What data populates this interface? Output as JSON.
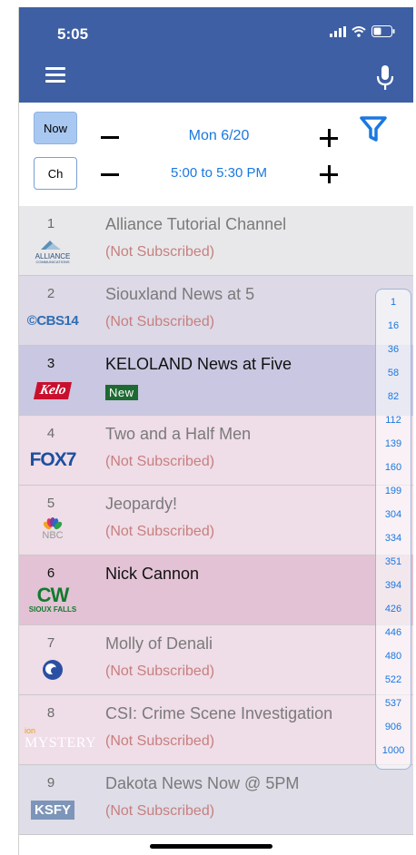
{
  "status_bar": {
    "time": "5:05"
  },
  "controls": {
    "now_label": "Now",
    "ch_label": "Ch",
    "date_text": "Mon 6/20",
    "time_range_text": "5:00 to 5:30 PM"
  },
  "channels": [
    {
      "num": "1",
      "title": "Alliance Tutorial Channel",
      "status": "(Not Subscribed)",
      "logo": "ALLIANCE",
      "logo_sub": "COMMUNICATIONS",
      "bg": "#e8e8ea"
    },
    {
      "num": "2",
      "title": "Siouxland News at 5",
      "status": "(Not Subscribed)",
      "logo": "©CBS14",
      "bg": "#ddd9e6"
    },
    {
      "num": "3",
      "title": "KELOLAND News at Five",
      "status": "New",
      "logo": "Kelo",
      "bg": "#c9c7e1"
    },
    {
      "num": "4",
      "title": "Two and a Half Men",
      "status": "(Not Subscribed)",
      "logo": "FOX7",
      "bg": "#efdde7"
    },
    {
      "num": "5",
      "title": "Jeopardy!",
      "status": "(Not Subscribed)",
      "logo": "NBC",
      "bg": "#efdde7"
    },
    {
      "num": "6",
      "title": "Nick Cannon",
      "status": "",
      "logo": "CW",
      "logo_sub": "SIOUX FALLS",
      "bg": "#e2c2d4"
    },
    {
      "num": "7",
      "title": "Molly of Denali",
      "status": "(Not Subscribed)",
      "logo": "PBS",
      "bg": "#efdde7"
    },
    {
      "num": "8",
      "title": "CSI: Crime Scene Investigation",
      "status": "(Not Subscribed)",
      "logo": "MYSTERY",
      "logo_top": "ion",
      "bg": "#efdde7"
    },
    {
      "num": "9",
      "title": "Dakota News Now @ 5PM",
      "status": "(Not Subscribed)",
      "logo": "KSFY",
      "bg": "#dedde8"
    }
  ],
  "scrubber": [
    "1",
    "16",
    "36",
    "58",
    "82",
    "112",
    "139",
    "160",
    "199",
    "304",
    "334",
    "351",
    "394",
    "426",
    "446",
    "480",
    "522",
    "537",
    "906",
    "1000"
  ],
  "icons": [
    "hamburger-icon",
    "microphone-icon",
    "filter-icon",
    "signal-icon",
    "wifi-icon",
    "battery-icon"
  ],
  "colors": {
    "header": "#3e5fa3",
    "accent": "#1a78e0",
    "now_button": "#a9c8f1",
    "new_badge": "#1e6a33",
    "not_subscribed": "#c77f7f"
  }
}
